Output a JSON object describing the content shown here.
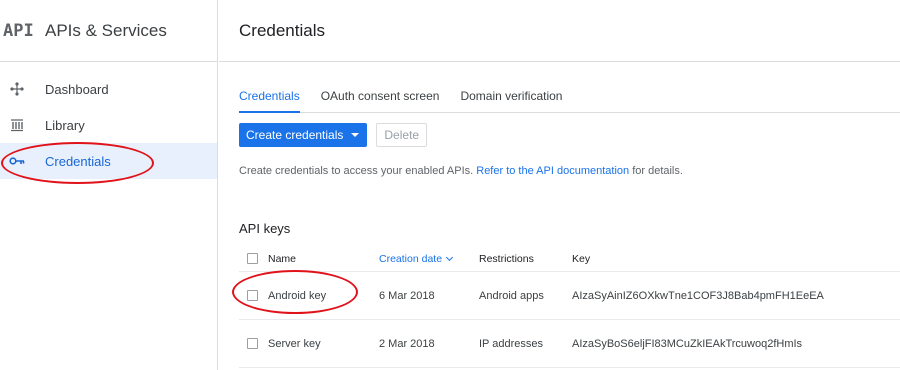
{
  "app": {
    "logo_text": "API",
    "title": "APIs & Services"
  },
  "sidebar": {
    "items": [
      {
        "label": "Dashboard",
        "icon": "dashboard-icon",
        "active": false
      },
      {
        "label": "Library",
        "icon": "library-icon",
        "active": false
      },
      {
        "label": "Credentials",
        "icon": "key-icon",
        "active": true
      }
    ]
  },
  "page": {
    "title": "Credentials"
  },
  "tabs": [
    {
      "label": "Credentials",
      "active": true
    },
    {
      "label": "OAuth consent screen",
      "active": false
    },
    {
      "label": "Domain verification",
      "active": false
    }
  ],
  "toolbar": {
    "create_label": "Create credentials",
    "delete_label": "Delete"
  },
  "info": {
    "text": "Create credentials to access your enabled APIs.",
    "link_text": "Refer to the API documentation",
    "suffix": "for details."
  },
  "api_keys": {
    "section_title": "API keys",
    "columns": {
      "name": "Name",
      "date": "Creation date",
      "restrictions": "Restrictions",
      "key": "Key"
    },
    "rows": [
      {
        "name": "Android key",
        "date": "6 Mar 2018",
        "restrictions": "Android apps",
        "key": "AIzaSyAinIZ6OXkwTne1COF3J8Bab4pmFH1EeEA"
      },
      {
        "name": "Server key",
        "date": "2 Mar 2018",
        "restrictions": "IP addresses",
        "key": "AIzaSyBoS6eljFI83MCuZkIEAkTrcuwoq2fHmIs"
      }
    ]
  },
  "colors": {
    "accent": "#1a73e8",
    "annotation": "#e0131b"
  }
}
